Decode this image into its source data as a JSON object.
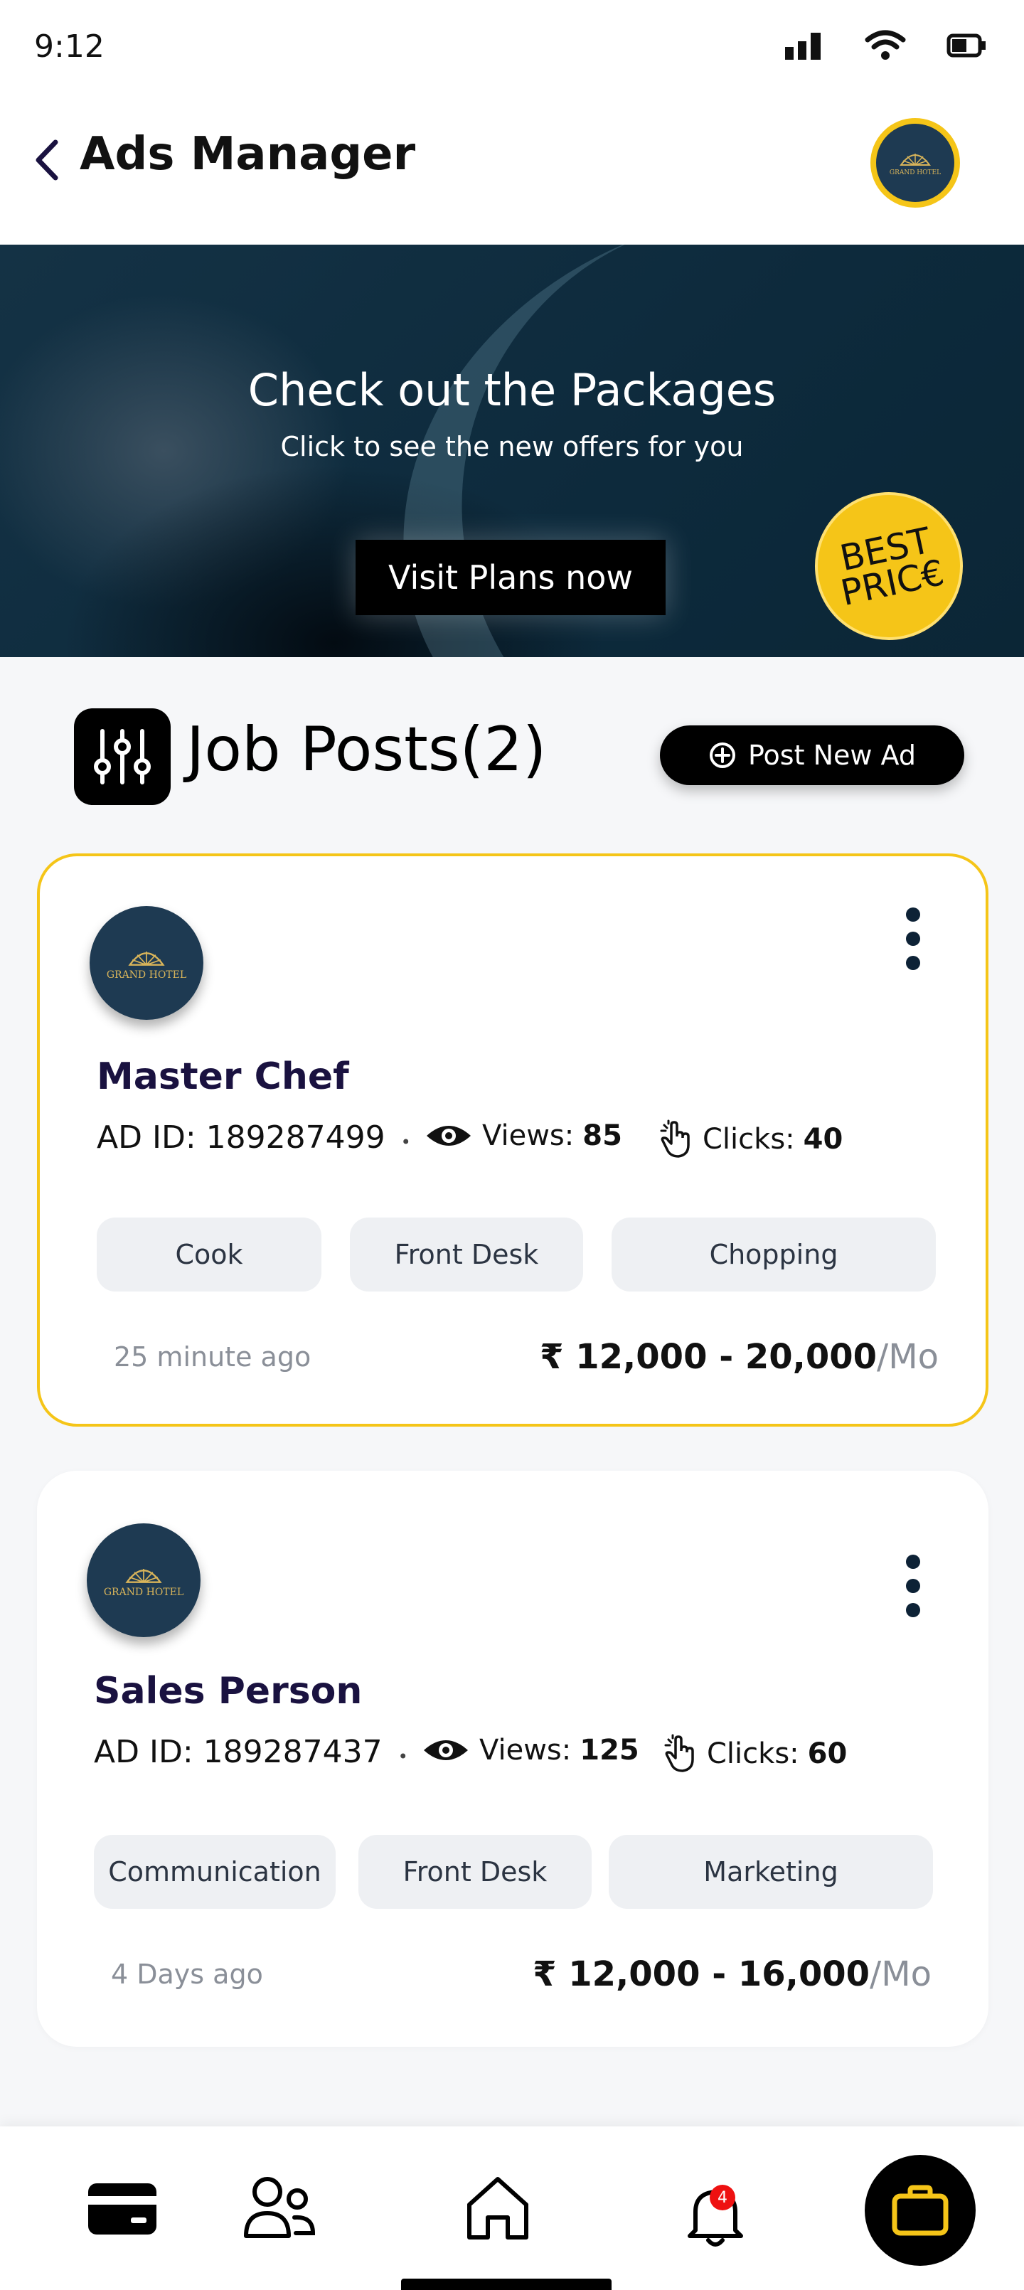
{
  "status_bar": {
    "time": "9:12"
  },
  "header": {
    "title": "Ads Manager",
    "avatar_logo": "GRAND HOTEL"
  },
  "banner": {
    "title": "Check out the Packages",
    "subtitle": "Click to see the new offers for you",
    "button": "Visit Plans now",
    "badge_line1": "BEST",
    "badge_line2": "PRIC€"
  },
  "section": {
    "title": "Job Posts(2)",
    "post_button": "Post New Ad"
  },
  "posts": [
    {
      "title": "Master Chef",
      "ad_id_label": "AD ID:",
      "ad_id": "189287499",
      "views_label": "Views:",
      "views": "85",
      "clicks_label": "Clicks:",
      "clicks": "40",
      "tags": [
        "Cook",
        "Front Desk",
        "Chopping"
      ],
      "ago": "25 minute ago",
      "salary": "₹ 12,000 - 20,000",
      "period": "/Mo",
      "logo": "GRAND HOTEL"
    },
    {
      "title": "Sales Person",
      "ad_id_label": "AD ID:",
      "ad_id": "189287437",
      "views_label": "Views:",
      "views": "125",
      "clicks_label": "Clicks:",
      "clicks": "60",
      "tags": [
        "Communication",
        "Front Desk",
        "Marketing"
      ],
      "ago": "4 Days ago",
      "salary": "₹ 12,000 - 16,000",
      "period": "/Mo",
      "logo": "GRAND HOTEL"
    }
  ],
  "nav": {
    "notification_count": "4"
  },
  "colors": {
    "accent": "#f5c518",
    "dark": "#0d2a3c",
    "brand_navy": "#1e3a52"
  }
}
